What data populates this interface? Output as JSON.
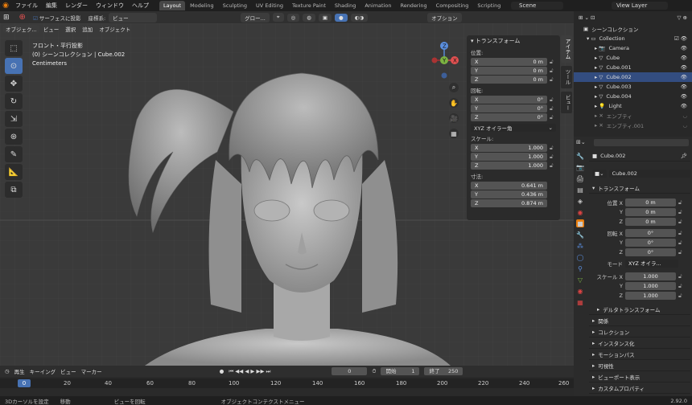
{
  "topbar": {
    "menu": [
      "ファイル",
      "編集",
      "レンダー",
      "ウィンドウ",
      "ヘルプ"
    ],
    "workspaces": [
      "Layout",
      "Modeling",
      "Sculpting",
      "UV Editing",
      "Texture Paint",
      "Shading",
      "Animation",
      "Rendering",
      "Compositing",
      "Scripting"
    ],
    "scene": "Scene",
    "view_layer": "View Layer"
  },
  "viewport_header": {
    "snap_surface": "サーフェスに投影",
    "orient_label": "座標系:",
    "orient_value": "ビュー",
    "pivot": "グロー...",
    "options": "オプション"
  },
  "viewport_header2": {
    "mode": "オブジェク...",
    "items": [
      "ビュー",
      "選択",
      "追加",
      "オブジェクト"
    ]
  },
  "viewport_info": {
    "line1": "フロント・平行投影",
    "line2": "(0) シーンコレクション | Cube.002",
    "line3": "Centimeters"
  },
  "npanel": {
    "title": "トランスフォーム",
    "location_label": "位置:",
    "rotation_label": "回転:",
    "scale_label": "スケール:",
    "dims_label": "寸法:",
    "mode_value": "XYZ オイラー角",
    "loc": [
      {
        "axis": "X",
        "val": "0 m"
      },
      {
        "axis": "Y",
        "val": "0 m"
      },
      {
        "axis": "Z",
        "val": "0 m"
      }
    ],
    "rot": [
      {
        "axis": "X",
        "val": "0°"
      },
      {
        "axis": "Y",
        "val": "0°"
      },
      {
        "axis": "Z",
        "val": "0°"
      }
    ],
    "scale": [
      {
        "axis": "X",
        "val": "1.000"
      },
      {
        "axis": "Y",
        "val": "1.000"
      },
      {
        "axis": "Z",
        "val": "1.000"
      }
    ],
    "dims": [
      {
        "axis": "X",
        "val": "0.641 m"
      },
      {
        "axis": "Y",
        "val": "0.436 m"
      },
      {
        "axis": "Z",
        "val": "0.874 m"
      }
    ],
    "tabs": [
      "アイテム",
      "ツール",
      "ビュー"
    ]
  },
  "timeline": {
    "playback": "再生",
    "keying": "キーイング",
    "view": "ビュー",
    "marker": "マーカー",
    "current": "0",
    "start_label": "開始",
    "start": "1",
    "end_label": "終了",
    "end": "250",
    "ticks": [
      "0",
      "20",
      "40",
      "60",
      "80",
      "100",
      "120",
      "140",
      "160",
      "180",
      "200",
      "220",
      "240",
      "260"
    ]
  },
  "statusbar": {
    "items": [
      "3Dカーソルを設定",
      "移動",
      "ビューを回転",
      "オブジェクトコンテクストメニュー"
    ],
    "version": "2.92.0"
  },
  "outliner": {
    "root": "シーンコレクション",
    "items": [
      "Collection",
      "Camera",
      "Cube",
      "Cube.001",
      "Cube.002",
      "Cube.003",
      "Cube.004",
      "Light",
      "エンプティ",
      "エンプティ.001"
    ]
  },
  "properties": {
    "object_name": "Cube.002",
    "data_name": "Cube.002",
    "section_transform": "トランスフォーム",
    "loc_label": "位置 X",
    "rot_label": "回転 X",
    "mode_label": "モード",
    "mode_value": "XYZ オイラ...",
    "scale_label": "スケール X",
    "loc": [
      "0 m",
      "0 m",
      "0 m"
    ],
    "rot": [
      "0°",
      "0°",
      "0°"
    ],
    "scale": [
      "1.000",
      "1.000",
      "1.000"
    ],
    "sections": [
      "デルタトランスフォーム",
      "関係",
      "コレクション",
      "インスタンス化",
      "モーションパス",
      "可視性",
      "ビューポート表示",
      "カスタムプロパティ"
    ]
  }
}
